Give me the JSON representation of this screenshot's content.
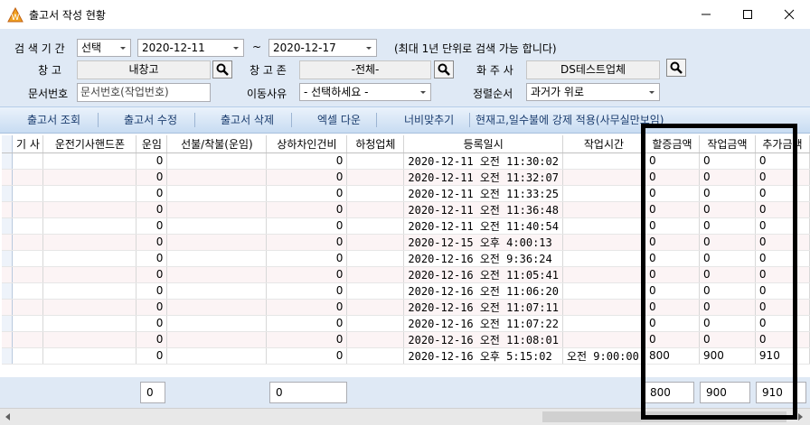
{
  "window": {
    "title": "출고서 작성 현황",
    "minimize": "—",
    "maximize": "☐",
    "close": "✕"
  },
  "filters": {
    "period_label": "검 색 기 간",
    "period_select": "선택",
    "date_from": "2020-12-11",
    "date_sep": "~",
    "date_to": "2020-12-17",
    "hint": "(최대 1년 단위로 검색 가능 합니다)",
    "warehouse_label": "창  고",
    "warehouse_value": "내창고",
    "zone_label": "창 고 존",
    "zone_value": "-전체-",
    "shipper_label": "화 주 사",
    "shipper_value": "DS테스트업체",
    "docno_label": "문서번호",
    "docno_placeholder": "문서번호(작업번호)",
    "reason_label": "이동사유",
    "reason_value": "- 선택하세요 -",
    "sort_label": "정렬순서",
    "sort_value": "과거가 위로"
  },
  "toolbar": {
    "buttons": [
      "출고서 조회",
      "출고서 수정",
      "출고서 삭제",
      "엑셀 다운",
      "너비맞추기",
      "현재고,일수불에 강제 적용(사무실만보임)"
    ]
  },
  "grid": {
    "columns": [
      "기 사",
      "운전기사핸드폰",
      "운임",
      "선불/착불(운임)",
      "상하차인건비",
      "하청업체",
      "등록일시",
      "작업시간",
      "할증금액",
      "작업금액",
      "추가금액"
    ],
    "rows": [
      [
        "",
        "",
        "0",
        "",
        "0",
        "",
        "2020-12-11 오전 11:30:02",
        "",
        "0",
        "0",
        "0"
      ],
      [
        "",
        "",
        "0",
        "",
        "0",
        "",
        "2020-12-11 오전 11:32:07",
        "",
        "0",
        "0",
        "0"
      ],
      [
        "",
        "",
        "0",
        "",
        "0",
        "",
        "2020-12-11 오전 11:33:25",
        "",
        "0",
        "0",
        "0"
      ],
      [
        "",
        "",
        "0",
        "",
        "0",
        "",
        "2020-12-11 오전 11:36:48",
        "",
        "0",
        "0",
        "0"
      ],
      [
        "",
        "",
        "0",
        "",
        "0",
        "",
        "2020-12-11 오전 11:40:54",
        "",
        "0",
        "0",
        "0"
      ],
      [
        "",
        "",
        "0",
        "",
        "0",
        "",
        "2020-12-15 오후 4:00:13",
        "",
        "0",
        "0",
        "0"
      ],
      [
        "",
        "",
        "0",
        "",
        "0",
        "",
        "2020-12-16 오전 9:36:24",
        "",
        "0",
        "0",
        "0"
      ],
      [
        "",
        "",
        "0",
        "",
        "0",
        "",
        "2020-12-16 오전 11:05:41",
        "",
        "0",
        "0",
        "0"
      ],
      [
        "",
        "",
        "0",
        "",
        "0",
        "",
        "2020-12-16 오전 11:06:20",
        "",
        "0",
        "0",
        "0"
      ],
      [
        "",
        "",
        "0",
        "",
        "0",
        "",
        "2020-12-16 오전 11:07:11",
        "",
        "0",
        "0",
        "0"
      ],
      [
        "",
        "",
        "0",
        "",
        "0",
        "",
        "2020-12-16 오전 11:07:22",
        "",
        "0",
        "0",
        "0"
      ],
      [
        "",
        "",
        "0",
        "",
        "0",
        "",
        "2020-12-16 오전 11:08:01",
        "",
        "0",
        "0",
        "0"
      ],
      [
        "",
        "",
        "0",
        "",
        "0",
        "",
        "2020-12-16 오후 5:15:02",
        "오전 9:00:00",
        "800",
        "900",
        "910"
      ]
    ]
  },
  "totals": {
    "fare": "0",
    "loading": "0",
    "surcharge": "800",
    "work": "900",
    "extra": "910"
  },
  "colors": {
    "form_bg": "#dfe9f5",
    "toolbar_text": "#1a3c6e",
    "row_alt": "#fcf4f5",
    "highlight": "#000000"
  }
}
